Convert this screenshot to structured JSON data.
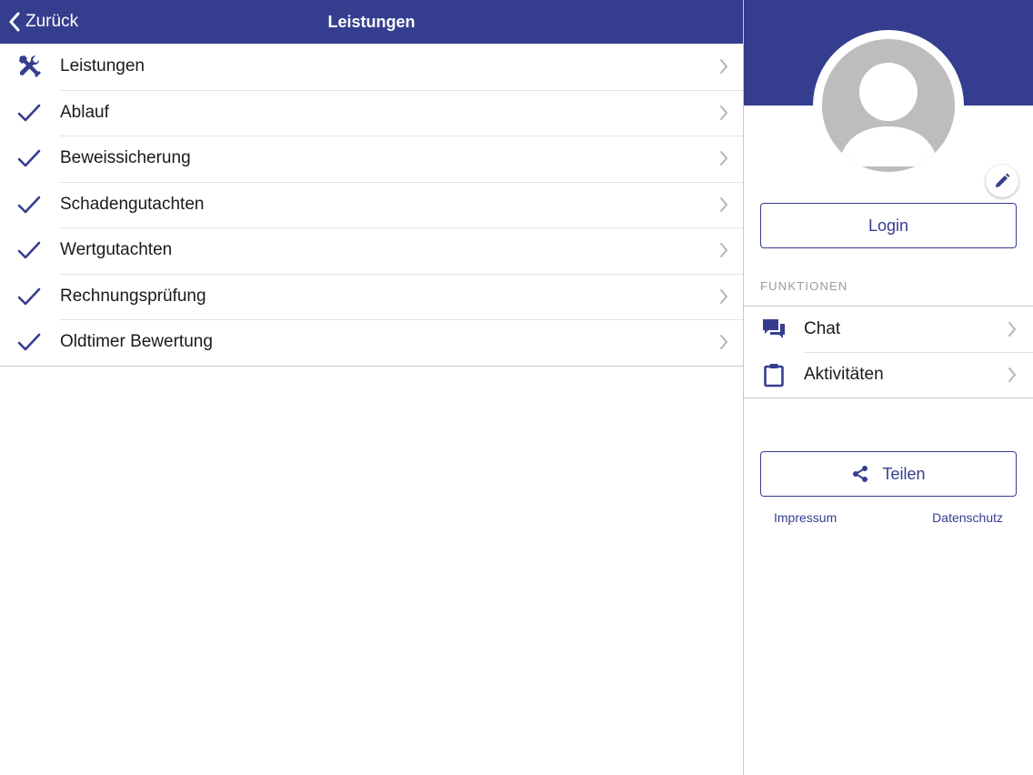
{
  "colors": {
    "primary": "#353e8e",
    "separator": "#c8c8cc",
    "chevron": "#b5b5ba",
    "avatar": "#bdbdbd"
  },
  "navbar": {
    "back_label": "Zurück",
    "back_icon": "chevron-left-icon",
    "title": "Leistungen"
  },
  "list": {
    "items": [
      {
        "label": "Leistungen",
        "icon": "tools-icon"
      },
      {
        "label": "Ablauf",
        "icon": "check-icon"
      },
      {
        "label": "Beweissicherung",
        "icon": "check-icon"
      },
      {
        "label": "Schadengutachten",
        "icon": "check-icon"
      },
      {
        "label": "Wertgutachten",
        "icon": "check-icon"
      },
      {
        "label": "Rechnungsprüfung",
        "icon": "check-icon"
      },
      {
        "label": "Oldtimer Bewertung",
        "icon": "check-icon"
      }
    ]
  },
  "profile": {
    "avatar_icon": "user-avatar-icon",
    "edit_icon": "pencil-icon"
  },
  "login": {
    "label": "Login"
  },
  "functions": {
    "section_label": "FUNKTIONEN",
    "items": [
      {
        "label": "Chat",
        "icon": "chat-icon"
      },
      {
        "label": "Aktivitäten",
        "icon": "clipboard-icon"
      }
    ]
  },
  "share": {
    "label": "Teilen",
    "icon": "share-icon"
  },
  "footer": {
    "impressum": "Impressum",
    "datenschutz": "Datenschutz"
  }
}
